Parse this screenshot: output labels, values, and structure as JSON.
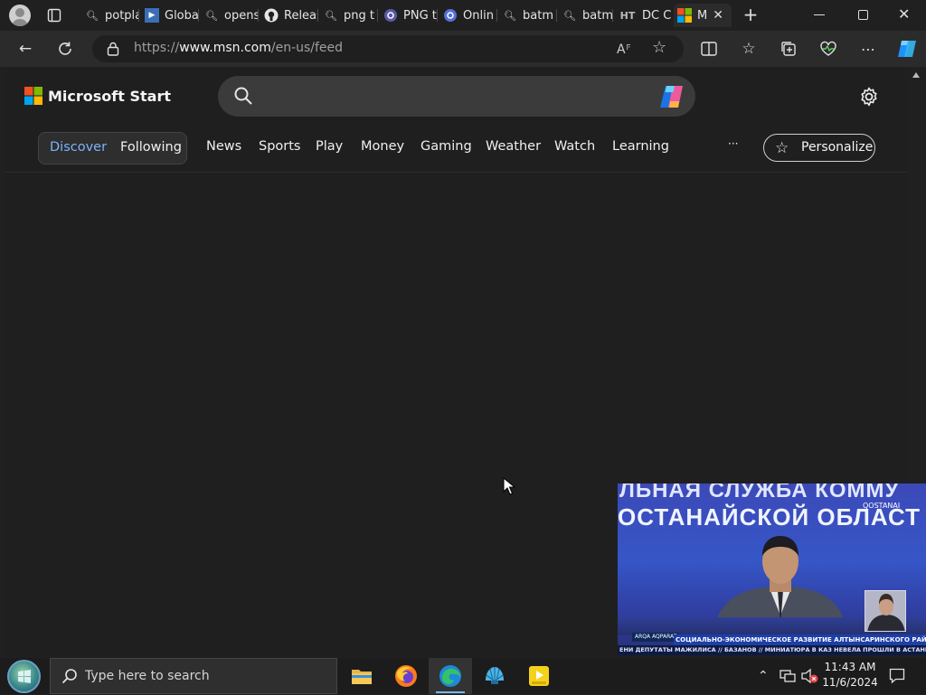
{
  "tabs": [
    {
      "label": "potpla",
      "icon": "search-icon"
    },
    {
      "label": "Globa",
      "icon": "play-icon"
    },
    {
      "label": "opens",
      "icon": "search-icon"
    },
    {
      "label": "Releas",
      "icon": "github-icon"
    },
    {
      "label": "png t",
      "icon": "search-icon"
    },
    {
      "label": "PNG t",
      "icon": "circle-logo-icon"
    },
    {
      "label": "Onlin",
      "icon": "circle-logo-icon"
    },
    {
      "label": "batm",
      "icon": "search-icon"
    },
    {
      "label": "batm",
      "icon": "search-icon"
    },
    {
      "label": "DC Co",
      "icon": "ht-logo-icon",
      "fav_text": "HT"
    },
    {
      "label": "M",
      "icon": "microsoft-logo-icon",
      "active": true
    }
  ],
  "address": {
    "prefix": "https://",
    "host": "www.msn.com",
    "path": "/en-us/feed"
  },
  "brand": {
    "name": "Microsoft Start"
  },
  "search": {
    "placeholder": ""
  },
  "feed_toggle": {
    "discover": "Discover",
    "following": "Following"
  },
  "nav": [
    "News",
    "Sports",
    "Play",
    "Money",
    "Gaming",
    "Weather",
    "Watch",
    "Learning"
  ],
  "more_label": "···",
  "personalize_label": "Personalize",
  "video": {
    "headline_top": "ЛЬНАЯ СЛУЖБА КОММУ",
    "headline_bottom": "ОСТАНАЙСКОЙ ОБЛАСТ",
    "channel": "QOSTANAI",
    "lower_third_tag": "ARQA AQPARAT",
    "lower_third": "СОЦИАЛЬНО-ЭКОНОМИЧЕСКОЕ РАЗВИТИЕ АЛТЫНСАРИНСКОГО РАЙОНА",
    "ticker": "ЕНИ ДЕПУТАТЫ МАЖИЛИСА  //  БАЗАНОВ  //  МИНИАТЮРА В КАЗ НЕВЕЛА ПРОШЛИ В АСТАНЕ НАУЧНОЕ КИНО"
  },
  "taskbar": {
    "search_placeholder": "Type here to search",
    "time": "11:43 AM",
    "date": "11/6/2024"
  },
  "colors": {
    "accent": "#76b9ed",
    "page_bg": "#1f1f1f",
    "chrome_bg": "#202020"
  }
}
